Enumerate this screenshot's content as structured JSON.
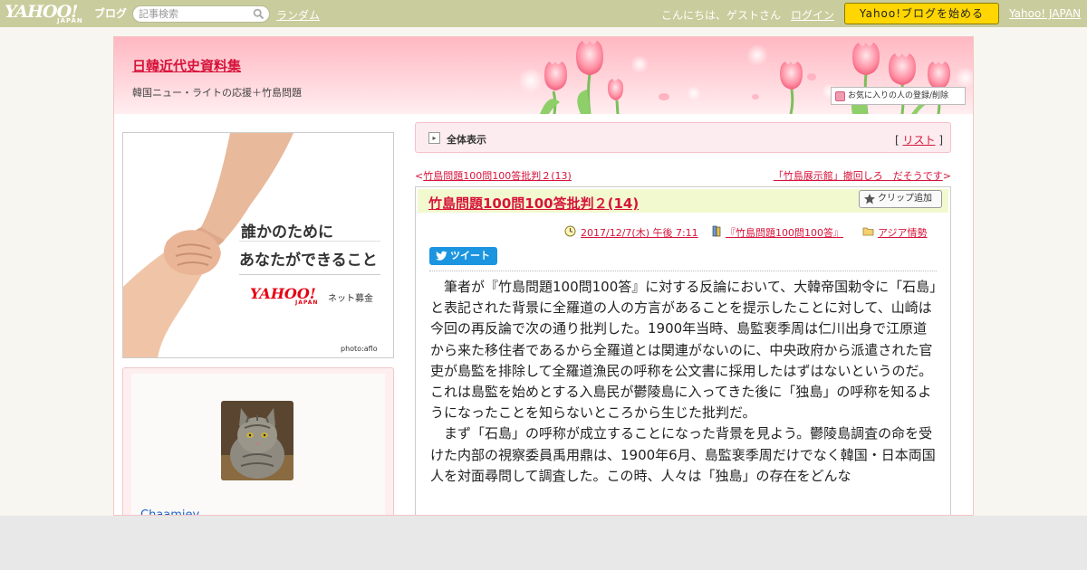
{
  "topbar": {
    "logo_yahoo": "YAHOO!",
    "logo_japan": "JAPAN",
    "logo_blog": "ブログ",
    "search_placeholder": "記事検索",
    "random_label": "ランダム",
    "greeting": "こんにちは、ゲストさん",
    "login_label": "ログイン",
    "start_button": "Yahoo!ブログを始める",
    "yahoo_japan_link": "Yahoo! JAPAN"
  },
  "header": {
    "blog_title": "日韓近代史資料集",
    "blog_description": "韓国ニュー・ライトの応援＋竹島問題",
    "favorite_button": "お気に入りの人の登録/削除"
  },
  "sidebar": {
    "banner": {
      "line1": "誰かのために",
      "line2": "あなたができること",
      "brand": "YAHOO!",
      "brand_sub": "JAPAN",
      "service": "ネット募金",
      "credit": "photo:aflo"
    },
    "profile": {
      "username": "Chaamiey"
    }
  },
  "main": {
    "all_view_label": "全体表示",
    "list_open": "[",
    "list_link": "リスト",
    "list_close": "]",
    "prev_marker": "<",
    "prev_title": "竹島問題100問100答批判２(13)",
    "next_title": "「竹島展示館」撤回しろ　だそうです",
    "next_marker": ">",
    "article": {
      "title": "竹島問題100問100答批判２(14)",
      "clip_button": "クリップ追加",
      "date": "2017/12/7(木) 午後 7:11",
      "book": "『竹島問題100問100答』",
      "category": "アジア情勢",
      "tweet_button": "ツイート",
      "paragraphs": [
        "筆者が『竹島問題100問100答』に対する反論において、大韓帝国勅令に「石島」と表記された背景に全羅道の人の方言があることを提示したことに対して、山崎は今回の再反論で次の通り批判した。1900年当時、島監裵季周は仁川出身で江原道から来た移住者であるから全羅道とは関連がないのに、中央政府から派遣された官吏が島監を排除して全羅道漁民の呼称を公文書に採用したはずはないというのだ。これは島監を始めとする入島民が鬱陵島に入ってきた後に「独島」の呼称を知るようになったことを知らないところから生じた批判だ。",
        "まず「石島」の呼称が成立することになった背景を見よう。鬱陵島調査の命を受けた内部の視察委員禹用鼎は、1900年6月、島監裵季周だけでなく韓国・日本両国人を対面尋問して調査した。この時、人々は「独島」の存在をどんな"
      ]
    }
  },
  "colors": {
    "topbar": "#c9cd9d",
    "accent_red": "#d6143b",
    "start_button": "#ffd600",
    "title_bar": "#f3f9cf",
    "tweet": "#1b95e0"
  }
}
